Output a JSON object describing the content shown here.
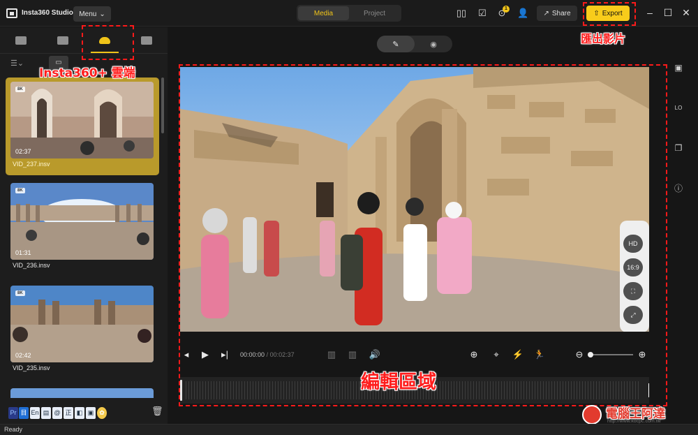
{
  "app": {
    "title": "Insta360 Studio",
    "menu_label": "Menu",
    "status": "Ready"
  },
  "mode_tabs": [
    {
      "label": "Media",
      "active": true
    },
    {
      "label": "Project",
      "active": false
    }
  ],
  "toolbar": {
    "share_label": "Share",
    "export_label": "Export",
    "notification_count": "1",
    "accent_color": "#f8cc1b"
  },
  "annotations": {
    "cloud": "Insta360+ 雲端",
    "export": "匯出影片",
    "edit_area": "編輯區域",
    "annotation_color": "#ff1a1a"
  },
  "panel_tabs": [
    "computer-icon",
    "folder-icon",
    "cloud-icon",
    "starred-folder-icon"
  ],
  "clips": [
    {
      "badge": "8K",
      "duration": "02:37",
      "name": "VID_237.insv",
      "selected": true
    },
    {
      "badge": "8K",
      "duration": "01:31",
      "name": "VID_236.insv",
      "selected": false
    },
    {
      "badge": "8K",
      "duration": "02:42",
      "name": "VID_235.insv",
      "selected": false
    }
  ],
  "player": {
    "current_time": "00:00:00",
    "total_time": "/ 00:02:37",
    "quality_label": "HD",
    "ratio_label": "16:9"
  },
  "tray_labels": [
    "Pr",
    "目",
    "En",
    "@",
    "正"
  ],
  "watermark": {
    "text": "電腦王阿達",
    "url": "http://www.kocpc.com.tw"
  }
}
